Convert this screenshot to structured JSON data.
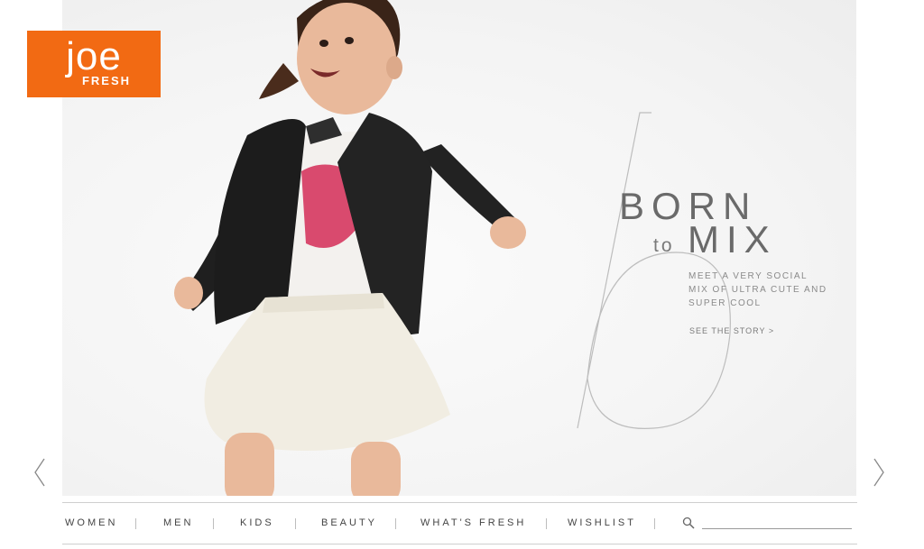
{
  "brand": {
    "line1": "JOE",
    "line2": "FRESH",
    "color": "#f26a13"
  },
  "hero": {
    "headline_top": "BORN",
    "headline_to": "to",
    "headline_bottom": "MIX",
    "copy_lines": [
      "MEET A VERY SOCIAL",
      "MIX OF ULTRA CUTE AND",
      "SUPER COOL"
    ],
    "cta": "SEE THE STORY >",
    "image": "toddler-in-leather-jacket-and-tutu"
  },
  "carousel": {
    "prev_icon": "chevron-left-icon",
    "next_icon": "chevron-right-icon"
  },
  "nav": {
    "items": [
      "WOMEN",
      "MEN",
      "KIDS",
      "BEAUTY",
      "WHAT'S FRESH",
      "WISHLIST"
    ],
    "search_icon": "search-icon",
    "search_value": ""
  }
}
